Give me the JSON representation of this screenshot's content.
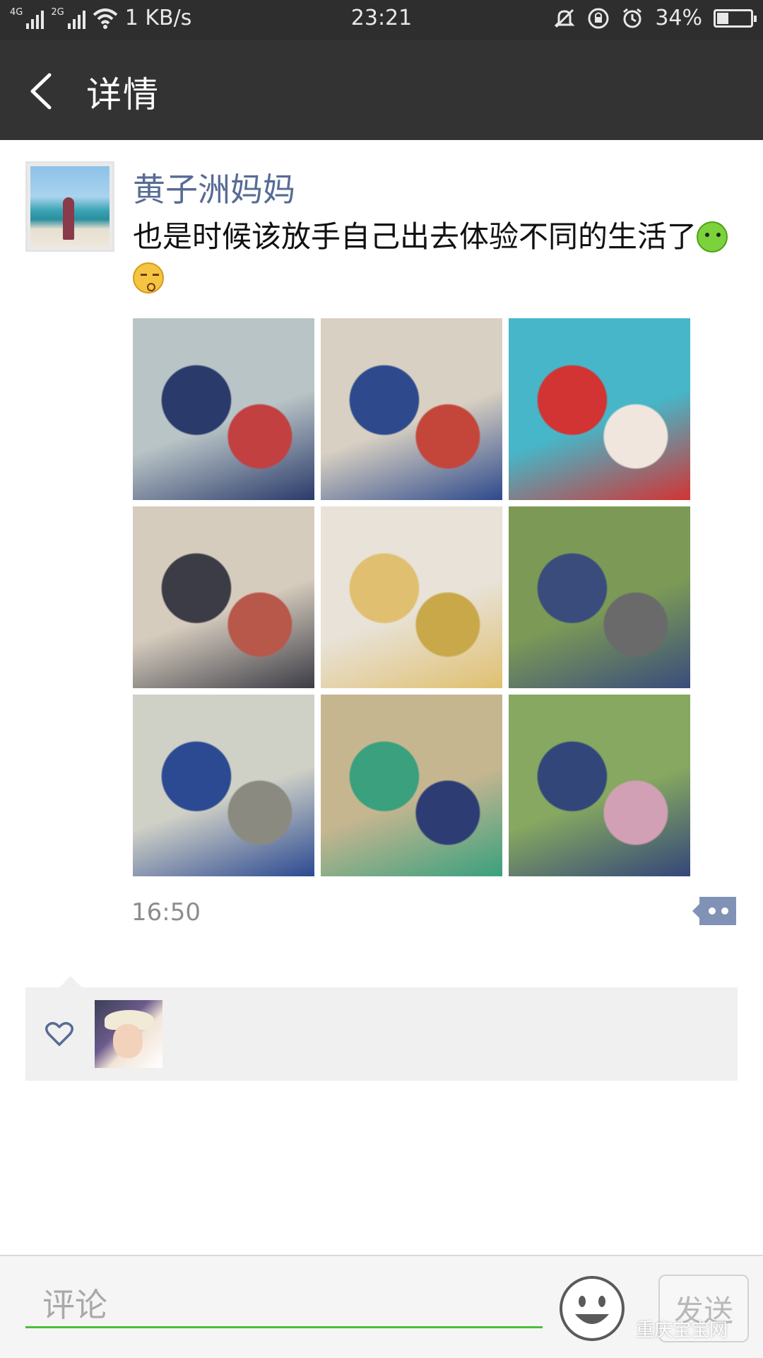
{
  "status_bar": {
    "net1": "4G",
    "net2": "2G",
    "speed": "1 KB/s",
    "time": "23:21",
    "battery_text": "34%",
    "battery_level": 0.34
  },
  "header": {
    "title": "详情"
  },
  "post": {
    "username": "黄子洲妈妈",
    "text": "也是时候该放手自己出去体验不同的生活了",
    "emojis": [
      "smile-face-emoji",
      "kissing-face-emoji"
    ],
    "timestamp": "16:50",
    "photos": [
      {
        "name": "photo-kids-at-table",
        "colors": [
          "#b9c4c6",
          "#2a3a6a",
          "#c24040"
        ]
      },
      {
        "name": "photo-boy-making-mooncake",
        "colors": [
          "#d8d0c2",
          "#2e4a8c",
          "#c4463a"
        ]
      },
      {
        "name": "photo-kids-red-costumes",
        "colors": [
          "#46b6c8",
          "#d23434",
          "#f0e6de"
        ]
      },
      {
        "name": "photo-crowded-classroom",
        "colors": [
          "#d6ccbe",
          "#3c3c46",
          "#b8584a"
        ]
      },
      {
        "name": "photo-mooncakes-tray",
        "colors": [
          "#e8e2d8",
          "#e0c070",
          "#c9a84a"
        ]
      },
      {
        "name": "photo-boy-rope-swing",
        "colors": [
          "#7c9a56",
          "#3a4c7c",
          "#6a6a6a"
        ]
      },
      {
        "name": "photo-boy-in-net",
        "colors": [
          "#cfd0c6",
          "#2c4a92",
          "#8a8a80"
        ]
      },
      {
        "name": "photo-rope-bridge",
        "colors": [
          "#c6b690",
          "#3aa07e",
          "#2e3c74"
        ]
      },
      {
        "name": "photo-climbing-rope",
        "colors": [
          "#86a860",
          "#33467a",
          "#d2a0b4"
        ]
      }
    ]
  },
  "likes": {
    "icon": "heart-icon"
  },
  "comment_bar": {
    "placeholder": "评论",
    "send_label": "发送"
  },
  "watermark": "重庆宝宝网",
  "colors": {
    "link_blue": "#576b95",
    "title_bar": "#333333",
    "input_underline": "#4cbf3a"
  }
}
